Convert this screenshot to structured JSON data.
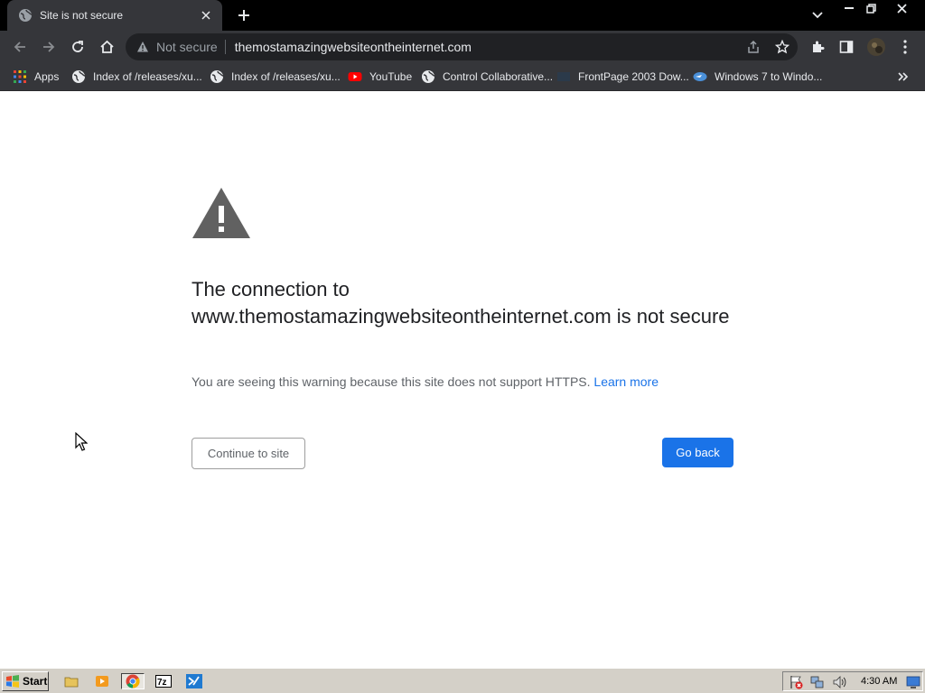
{
  "browser": {
    "tab": {
      "title": "Site is not secure"
    },
    "omnibox": {
      "security_label": "Not secure",
      "url": "themostamazingwebsiteontheinternet.com"
    },
    "bookmarks": [
      {
        "label": "Apps",
        "icon": "apps-grid-icon"
      },
      {
        "label": "Index of /releases/xu...",
        "icon": "globe-icon"
      },
      {
        "label": "Index of /releases/xu...",
        "icon": "globe-icon"
      },
      {
        "label": "YouTube",
        "icon": "youtube-icon"
      },
      {
        "label": "Control Collaborative...",
        "icon": "globe-icon"
      },
      {
        "label": "FrontPage 2003 Dow...",
        "icon": "frontpage-icon"
      },
      {
        "label": "Windows 7 to Windo...",
        "icon": "windows-bookmark-icon"
      }
    ]
  },
  "page": {
    "heading": "The connection to www.themostamazingwebsiteontheinternet.com is not secure",
    "explanation": "You are seeing this warning because this site does not support HTTPS.",
    "learn_more": "Learn more",
    "continue_label": "Continue to site",
    "goback_label": "Go back"
  },
  "taskbar": {
    "start_label": "Start",
    "clock": "4:30 AM"
  },
  "colors": {
    "accent": "#1a73e8",
    "chrome_dark": "#35363a",
    "taskbar": "#d4d0c8"
  }
}
